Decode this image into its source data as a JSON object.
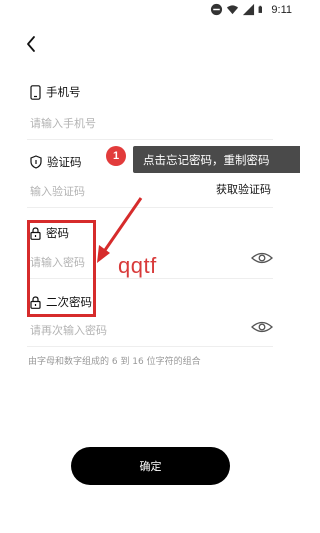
{
  "status_bar": {
    "time": "9:11",
    "icons": [
      "do-not-disturb-icon",
      "wifi-icon",
      "signal-icon",
      "battery-icon"
    ]
  },
  "form": {
    "phone": {
      "label": "手机号",
      "placeholder": "请输入手机号"
    },
    "code": {
      "label": "验证码",
      "placeholder": "输入验证码",
      "action": "获取验证码"
    },
    "password": {
      "label": "密码",
      "placeholder": "请输入密码"
    },
    "confirm_password": {
      "label": "二次密码",
      "placeholder": "请再次输入密码"
    },
    "hint": "由字母和数字组成的 6 到 16 位字符的组合",
    "submit": "确定"
  },
  "annotation": {
    "badge": "1",
    "tooltip": "点击忘记密码，重制密码",
    "handwriting": "qqtf",
    "color": "#d62b2b"
  }
}
